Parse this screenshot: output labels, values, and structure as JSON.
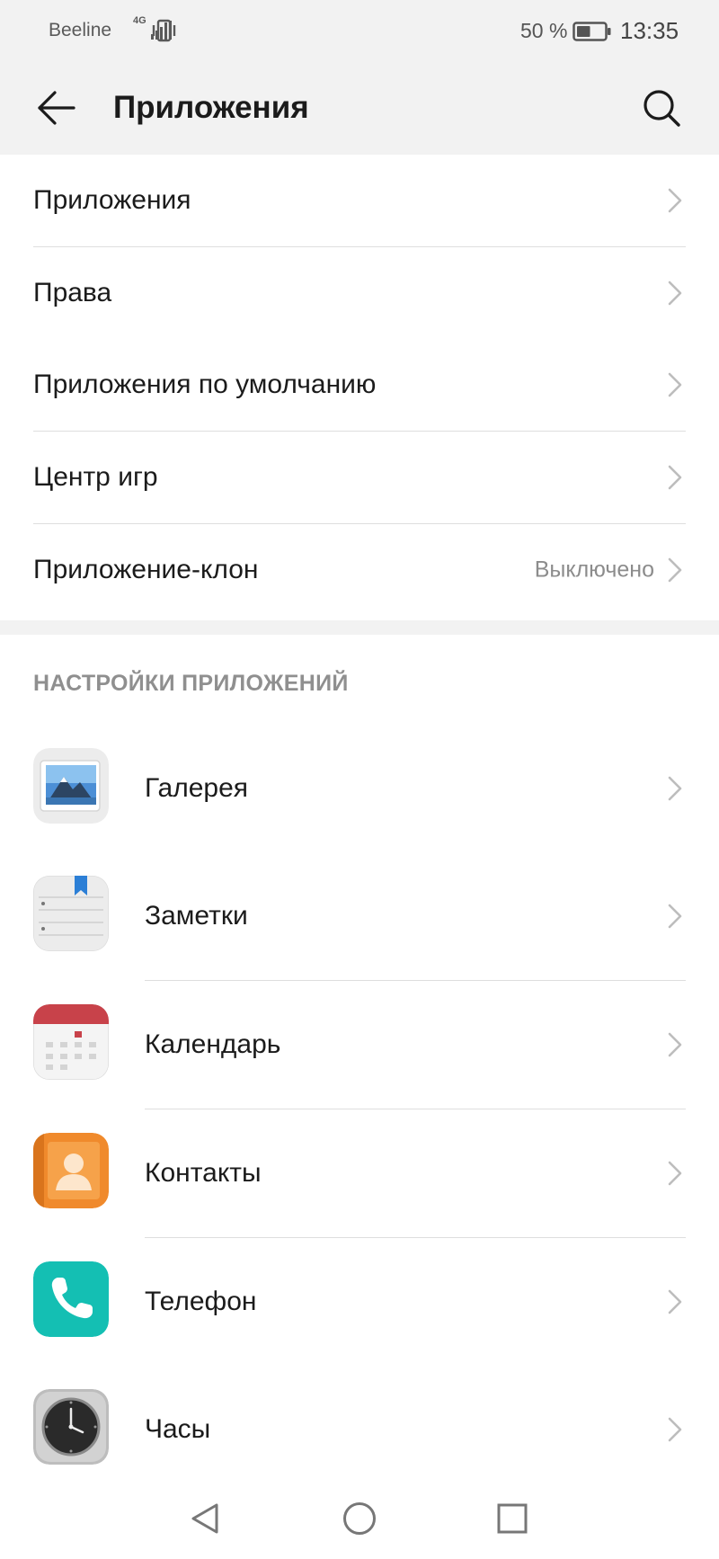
{
  "status_bar": {
    "carrier": "Beeline",
    "network_type": "4G",
    "battery_percent": "50 %",
    "battery_level": 0.5,
    "time": "13:35"
  },
  "app_bar": {
    "title": "Приложения",
    "back_icon": "arrow-left-icon",
    "search_icon": "search-icon"
  },
  "main_items": [
    {
      "label": "Приложения"
    },
    {
      "label": "Права"
    },
    {
      "label": "Приложения по умолчанию"
    },
    {
      "label": "Центр игр"
    },
    {
      "label": "Приложение-клон",
      "value": "Выключено"
    }
  ],
  "app_settings": {
    "section_title": "НАСТРОЙКИ ПРИЛОЖЕНИЙ",
    "apps": [
      {
        "label": "Галерея",
        "icon": "gallery-icon"
      },
      {
        "label": "Заметки",
        "icon": "notes-icon"
      },
      {
        "label": "Календарь",
        "icon": "calendar-icon"
      },
      {
        "label": "Контакты",
        "icon": "contacts-icon"
      },
      {
        "label": "Телефон",
        "icon": "phone-icon"
      },
      {
        "label": "Часы",
        "icon": "clock-icon"
      }
    ]
  },
  "nav_bar": {
    "back": "nav-back-icon",
    "home": "nav-home-icon",
    "recents": "nav-recents-icon"
  },
  "colors": {
    "header_bg": "#f2f2f2",
    "divider": "#dedede",
    "secondary_text": "#8c8c8c",
    "phone_teal": "#14bfb3",
    "contacts_orange": "#f08a2c",
    "calendar_red": "#c8424a"
  }
}
